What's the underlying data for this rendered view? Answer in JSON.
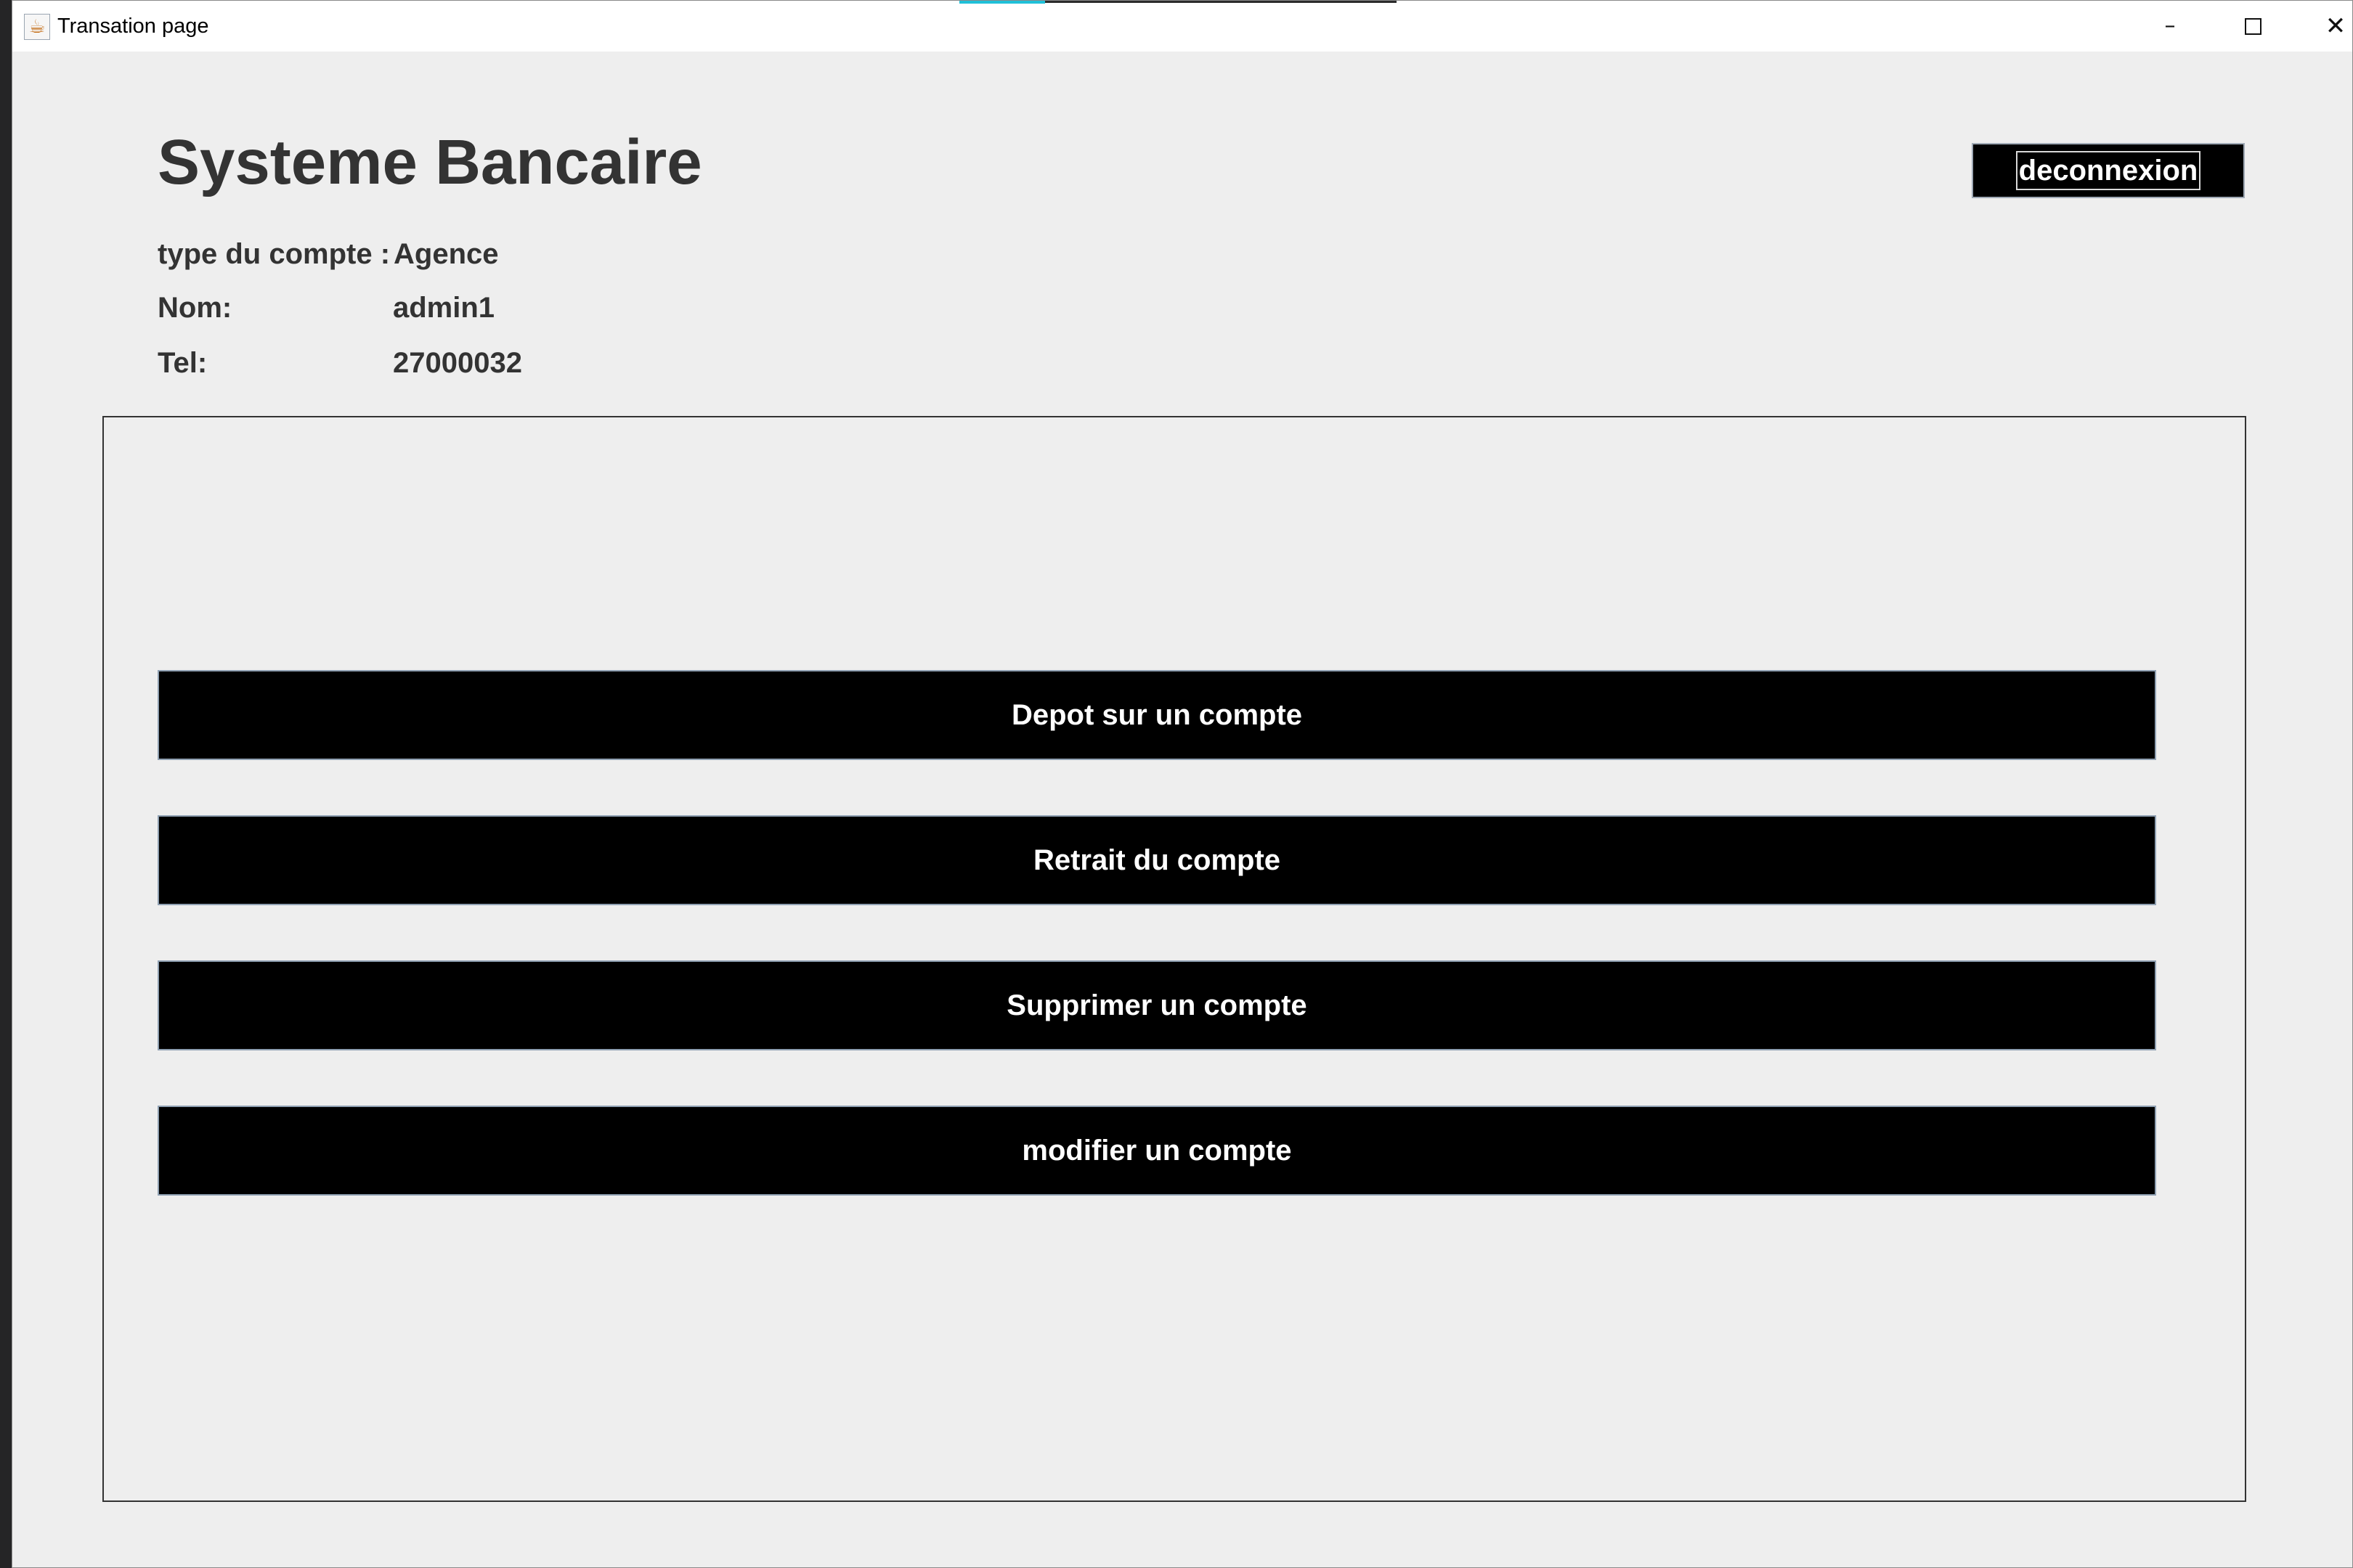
{
  "window": {
    "title": "Transation page",
    "app_icon": "java-cup-icon",
    "controls": {
      "minimize": "–",
      "maximize": "□",
      "close": "✕"
    },
    "accent_color": "#20c0d8"
  },
  "header": {
    "title": "Systeme Bancaire",
    "logout_label": "deconnexion"
  },
  "account": {
    "type_label": "type du compte :",
    "type_value": "Agence",
    "name_label": "Nom:",
    "name_value": "admin1",
    "tel_label": "Tel:",
    "tel_value": "27000032"
  },
  "actions": [
    {
      "label": "Depot sur un compte"
    },
    {
      "label": "Retrait du compte"
    },
    {
      "label": "Supprimer un compte"
    },
    {
      "label": "modifier un compte"
    }
  ]
}
